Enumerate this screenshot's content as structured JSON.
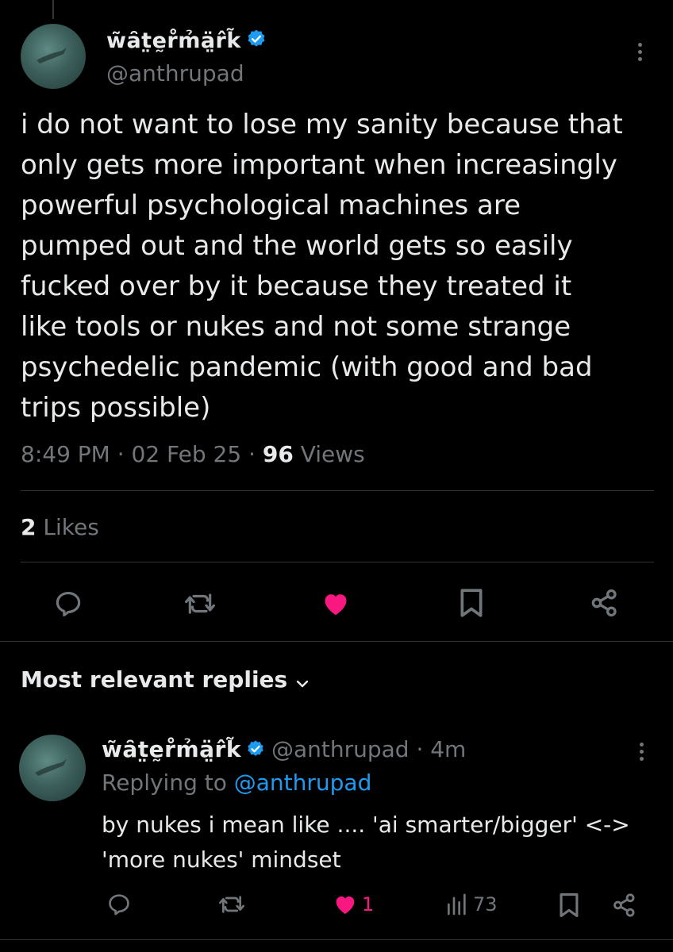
{
  "tweet": {
    "display_name": "w̃ȃt̤ḛr̊m̉ä̤r̂k̃",
    "handle": "@anthrupad",
    "text": "i do not want to lose my sanity because that\nonly gets more important when increasingly\npowerful psychological machines are\npumped out and the world gets so easily\nfucked over by it because they treated it\nlike tools or nukes and not some strange\npsychedelic pandemic (with good and bad\ntrips possible)",
    "time": "8:49 PM · 02 Feb 25 · ",
    "views_count": "96",
    "views_label": " Views",
    "likes_count": "2",
    "likes_label": " Likes",
    "actions": [
      "reply-icon",
      "retweet-icon",
      "heart-icon",
      "bookmark-icon",
      "share-icon"
    ],
    "liked": true
  },
  "replies_section": {
    "heading": "Most relevant replies"
  },
  "reply": {
    "display_name": "w̃ȃt̤ḛr̊m̉ä̤r̂k̃",
    "handle_time": "@anthrupad · 4m",
    "replying_label": "Replying to ",
    "replying_to": "@anthrupad",
    "text": "by nukes i mean like .... 'ai smarter/bigger' <->\n'more nukes' mindset",
    "likes_count": "1",
    "views_count": "73"
  },
  "colors": {
    "background": "#000000",
    "text": "#e7e9ea",
    "muted": "#71767b",
    "accent": "#1d9bf0",
    "like": "#f91880",
    "divider": "#2f3336"
  }
}
